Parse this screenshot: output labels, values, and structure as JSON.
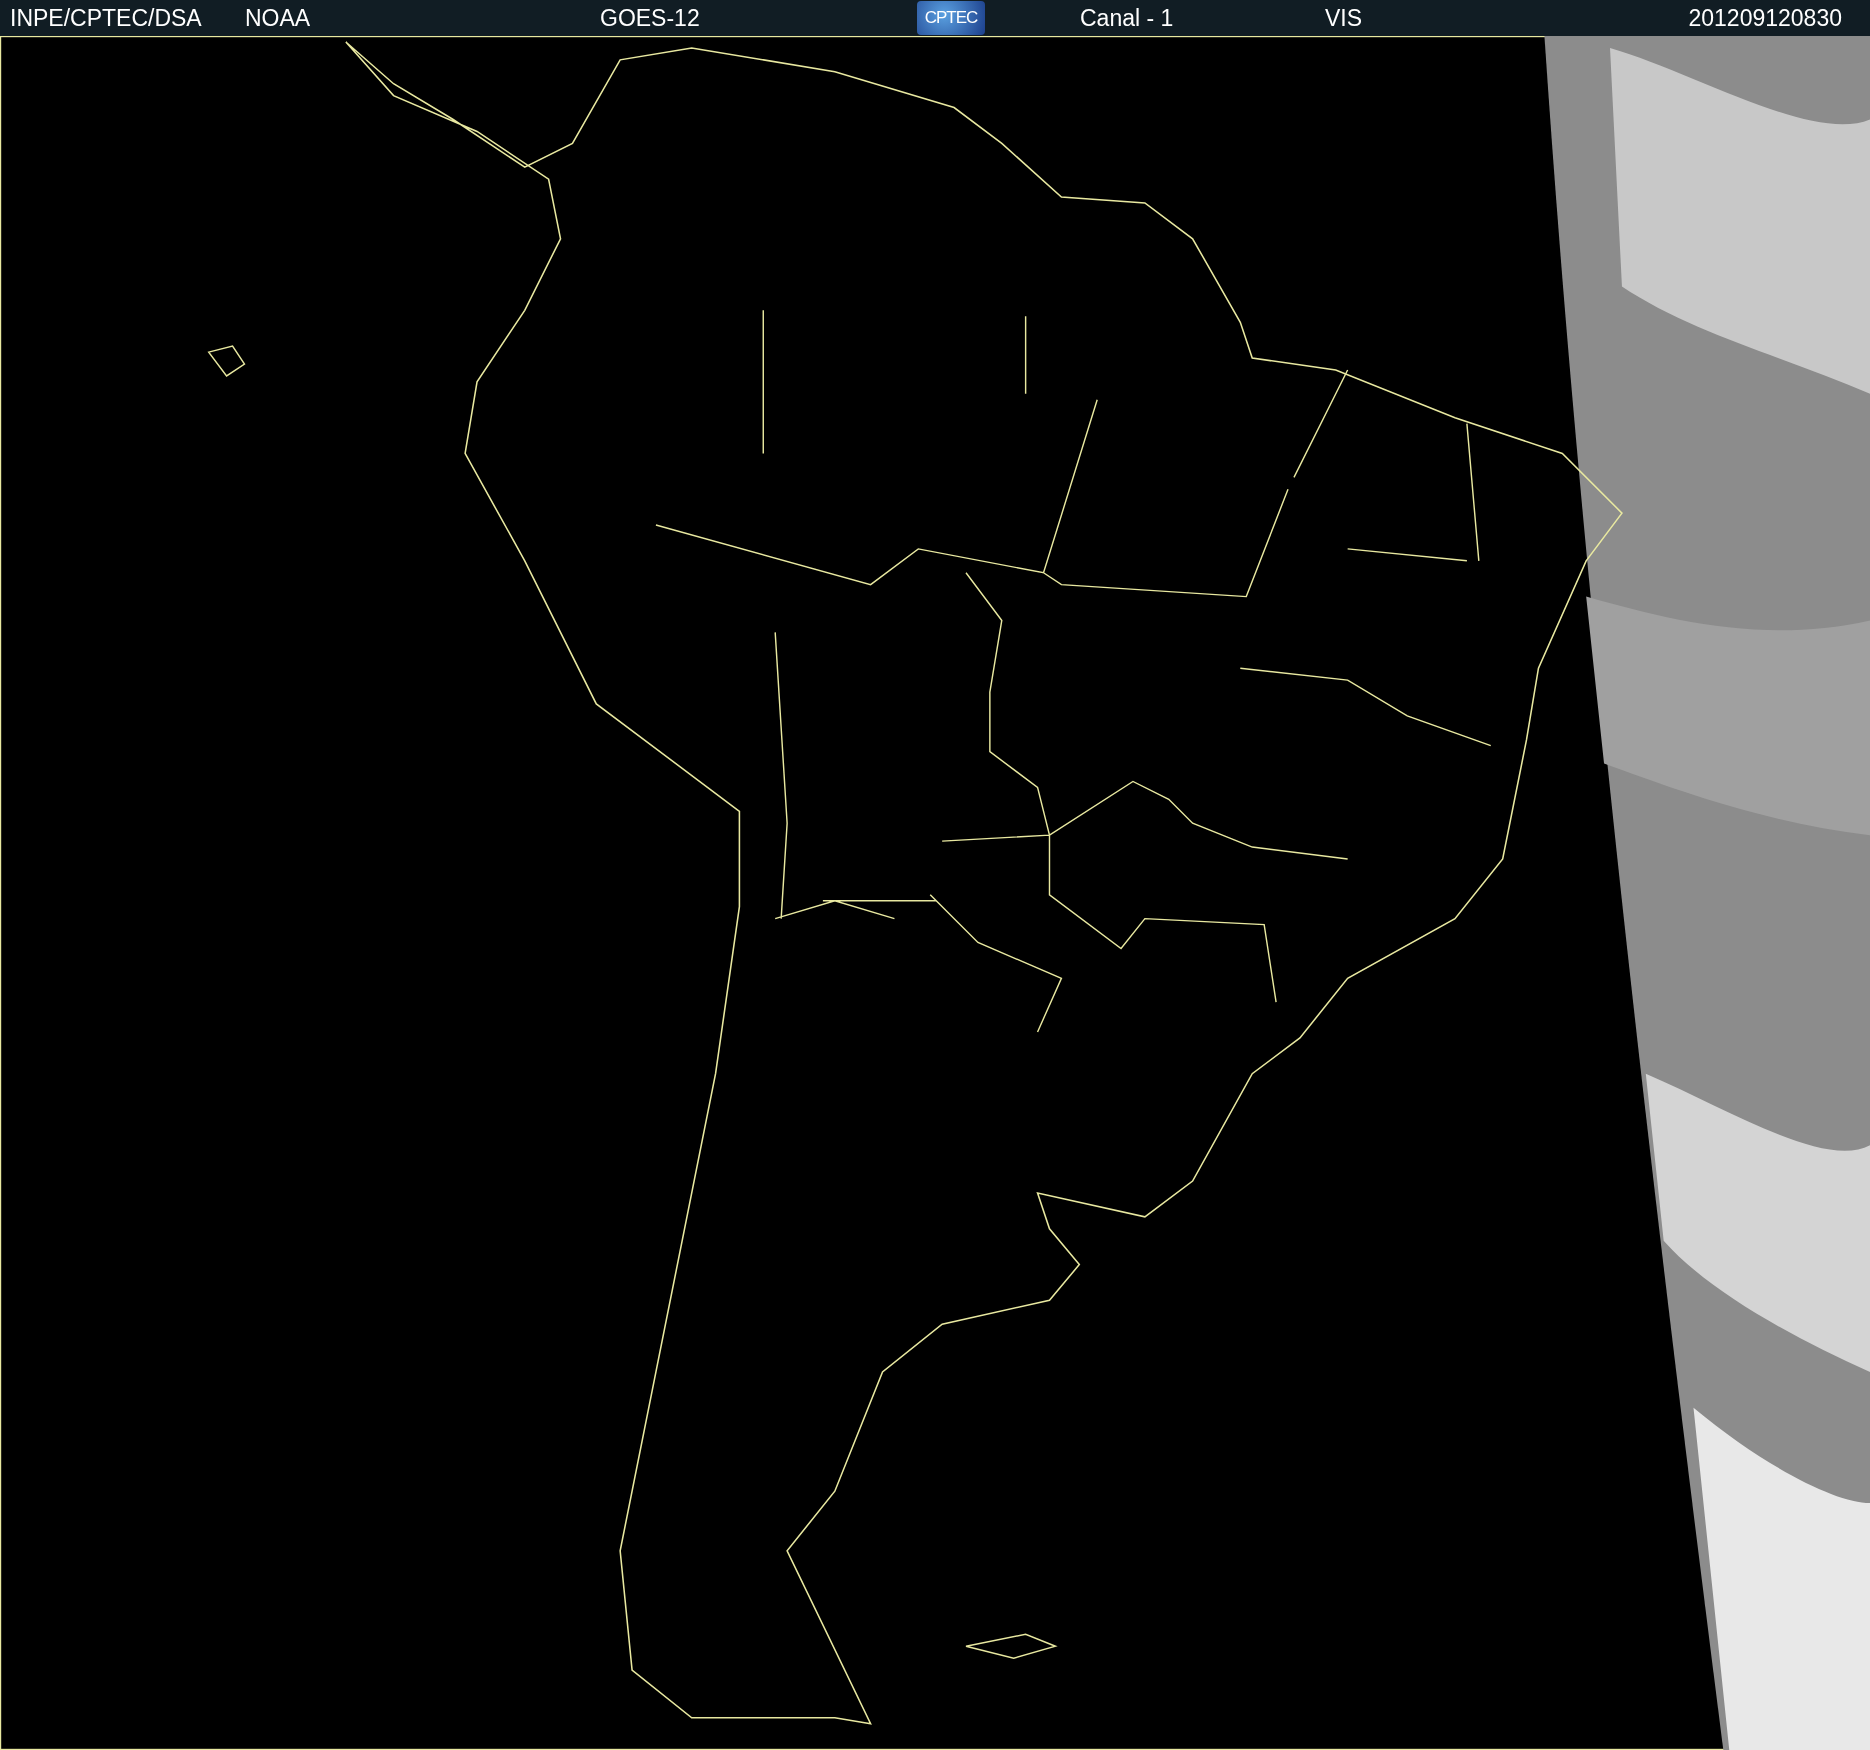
{
  "header": {
    "agency": "INPE/CPTEC/DSA",
    "source": "NOAA",
    "satellite": "GOES-12",
    "logo": "CPTEC",
    "channel": "Canal - 1",
    "band": "VIS",
    "timestamp": "201209120830"
  }
}
